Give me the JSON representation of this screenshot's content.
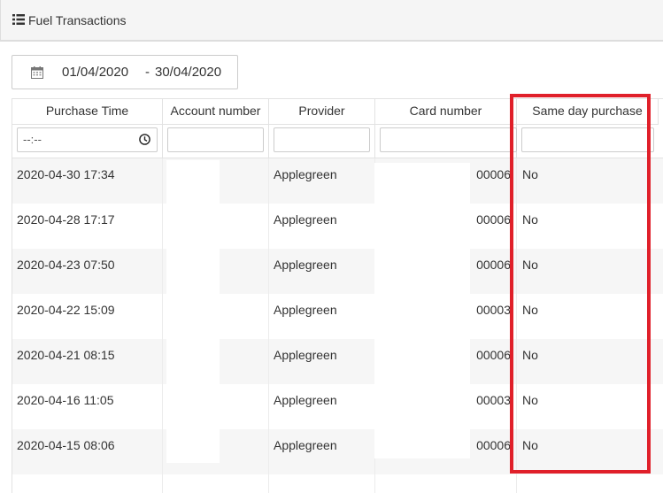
{
  "panel": {
    "title": "Fuel Transactions",
    "icon": "list-icon"
  },
  "daterange": {
    "icon": "calendar-icon",
    "from": "01/04/2020",
    "separator": "-",
    "to": "30/04/2020"
  },
  "table": {
    "columns": [
      "Purchase Time",
      "Account number",
      "Provider",
      "Card number",
      "Same day purchase"
    ],
    "filters": {
      "purchase_time_placeholder": "--:--"
    },
    "rows": [
      {
        "time": "2020-04-30 17:34",
        "account": "",
        "provider": "Applegreen",
        "card": "00006",
        "same_day": "No"
      },
      {
        "time": "2020-04-28 17:17",
        "account": "",
        "provider": "Applegreen",
        "card": "00006",
        "same_day": "No"
      },
      {
        "time": "2020-04-23 07:50",
        "account": "",
        "provider": "Applegreen",
        "card": "00006",
        "same_day": "No"
      },
      {
        "time": "2020-04-22 15:09",
        "account": "",
        "provider": "Applegreen",
        "card": "00003",
        "same_day": "No"
      },
      {
        "time": "2020-04-21 08:15",
        "account": "",
        "provider": "Applegreen",
        "card": "00006",
        "same_day": "No"
      },
      {
        "time": "2020-04-16 11:05",
        "account": "",
        "provider": "Applegreen",
        "card": "00003",
        "same_day": "No"
      },
      {
        "time": "2020-04-15 08:06",
        "account": "",
        "provider": "Applegreen",
        "card": "00006",
        "same_day": "No"
      }
    ]
  },
  "colors": {
    "highlight": "#e0202a",
    "row_alt": "#f6f6f6",
    "header_bg": "#f5f5f5"
  }
}
